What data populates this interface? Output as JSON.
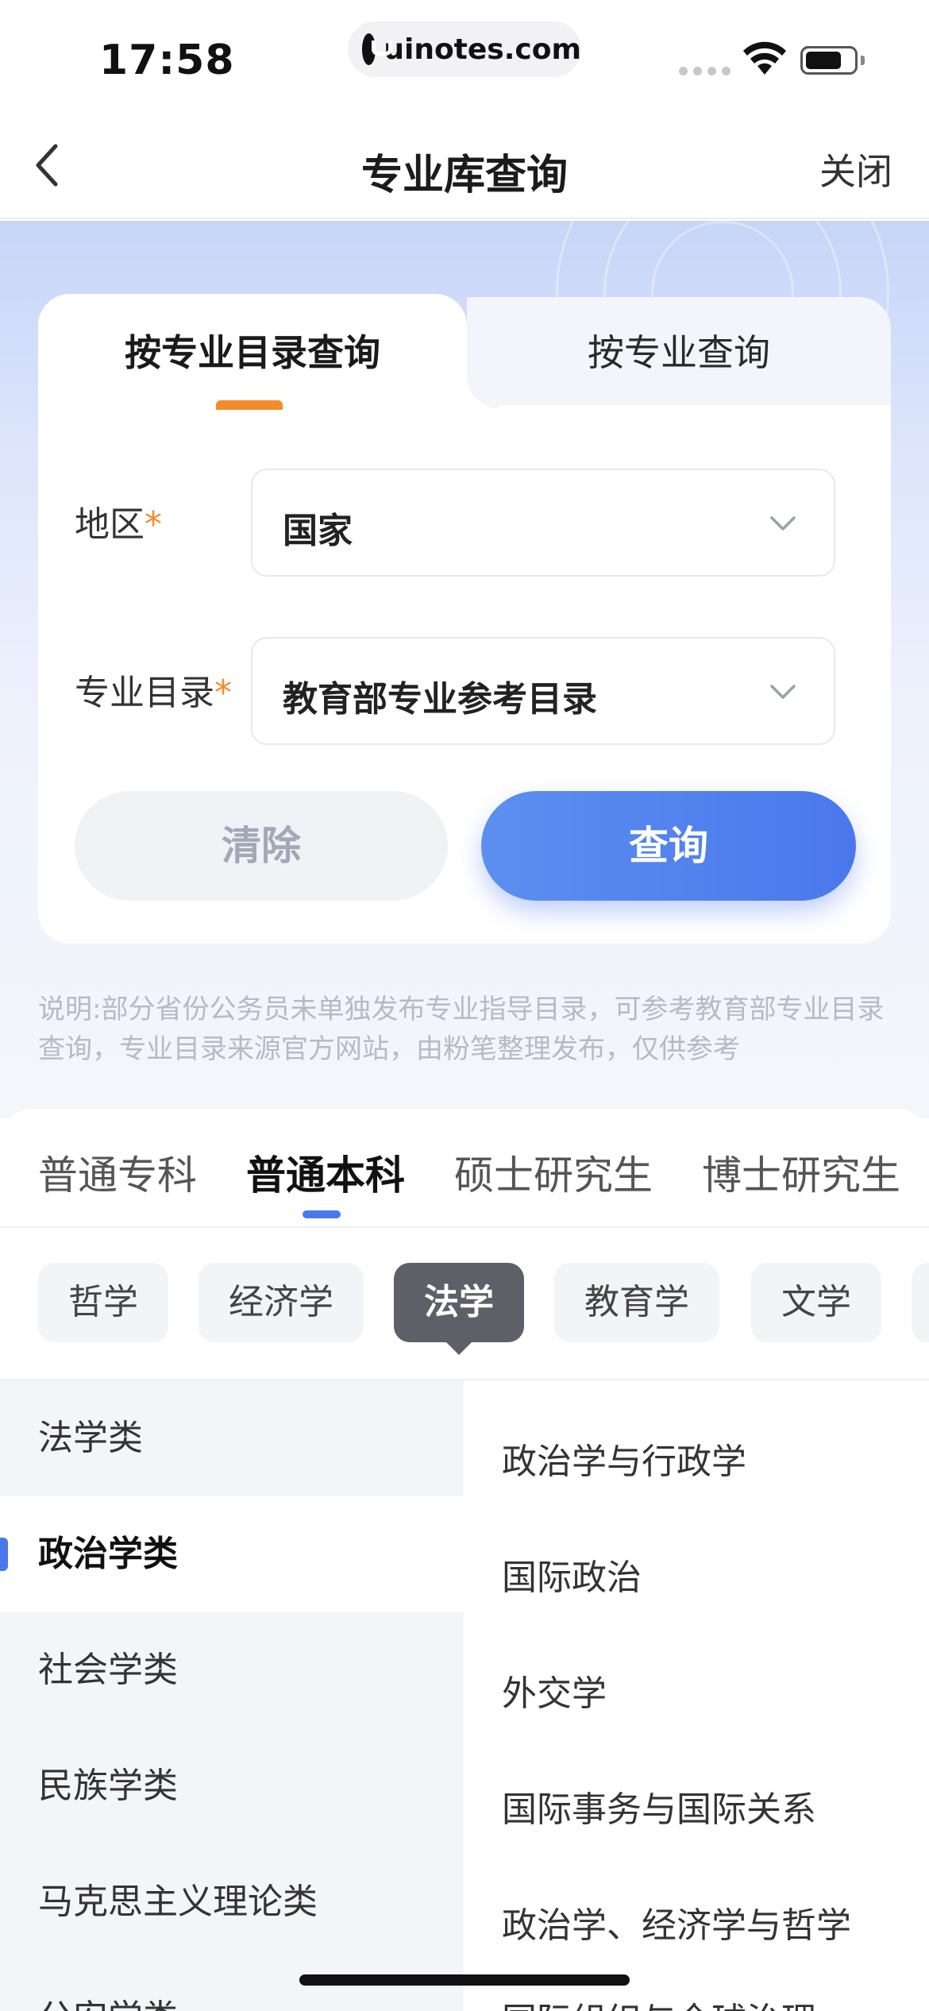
{
  "status_bar": {
    "time": "17:58",
    "url": "uinotes.com"
  },
  "nav": {
    "title": "专业库查询",
    "close_label": "关闭",
    "back_icon": "chevron-left-icon"
  },
  "query_card": {
    "tabs": [
      {
        "label": "按专业目录查询",
        "active": true
      },
      {
        "label": "按专业查询",
        "active": false
      }
    ],
    "region": {
      "label": "地区",
      "required_mark": "*",
      "value": "国家"
    },
    "catalog": {
      "label": "专业目录",
      "required_mark": "*",
      "value": "教育部专业参考目录"
    },
    "clear_label": "清除",
    "query_label": "查询"
  },
  "note": "说明:部分省份公务员未单独发布专业指导目录，可参考教育部专业目录查询，专业目录来源官方网站，由粉笔整理发布，仅供参考",
  "levels": [
    {
      "label": "普通专科",
      "active": false
    },
    {
      "label": "普通本科",
      "active": true
    },
    {
      "label": "硕士研究生",
      "active": false
    },
    {
      "label": "博士研究生",
      "active": false
    }
  ],
  "subjects": [
    {
      "label": "哲学",
      "active": false
    },
    {
      "label": "经济学",
      "active": false
    },
    {
      "label": "法学",
      "active": true
    },
    {
      "label": "教育学",
      "active": false
    },
    {
      "label": "文学",
      "active": false
    }
  ],
  "categories": [
    {
      "label": "法学类",
      "active": false
    },
    {
      "label": "政治学类",
      "active": true
    },
    {
      "label": "社会学类",
      "active": false
    },
    {
      "label": "民族学类",
      "active": false
    },
    {
      "label": "马克思主义理论类",
      "active": false
    },
    {
      "label": "公安学类",
      "active": false
    }
  ],
  "majors": [
    "政治学与行政学",
    "国际政治",
    "外交学",
    "国际事务与国际关系",
    "政治学、经济学与哲学",
    "国际组织与全球治理"
  ],
  "colors": {
    "accent_blue": "#4a78ec",
    "accent_orange": "#f28c28",
    "chip_active": "#5f6067"
  }
}
